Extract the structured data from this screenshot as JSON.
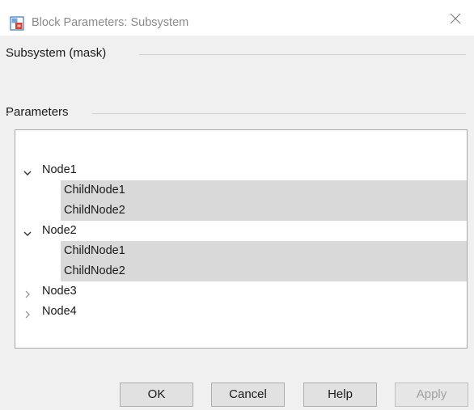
{
  "window": {
    "title": "Block Parameters: Subsystem",
    "icon": "simulink-block-icon",
    "close_icon": "close-icon"
  },
  "groups": {
    "mask_header": "Subsystem (mask)",
    "parameters_header": "Parameters"
  },
  "tree": {
    "nodes": [
      {
        "label": "Node1",
        "expanded": true,
        "children": [
          "ChildNode1",
          "ChildNode2"
        ]
      },
      {
        "label": "Node2",
        "expanded": true,
        "children": [
          "ChildNode1",
          "ChildNode2"
        ]
      },
      {
        "label": "Node3",
        "expanded": false,
        "children": []
      },
      {
        "label": "Node4",
        "expanded": false,
        "children": []
      }
    ]
  },
  "buttons": {
    "ok": "OK",
    "cancel": "Cancel",
    "help": "Help",
    "apply": "Apply"
  },
  "colors": {
    "selection_gray": "#d9d9d9",
    "dialog_bg": "#f0f0f0",
    "disabled_text": "#a0a0a0"
  }
}
